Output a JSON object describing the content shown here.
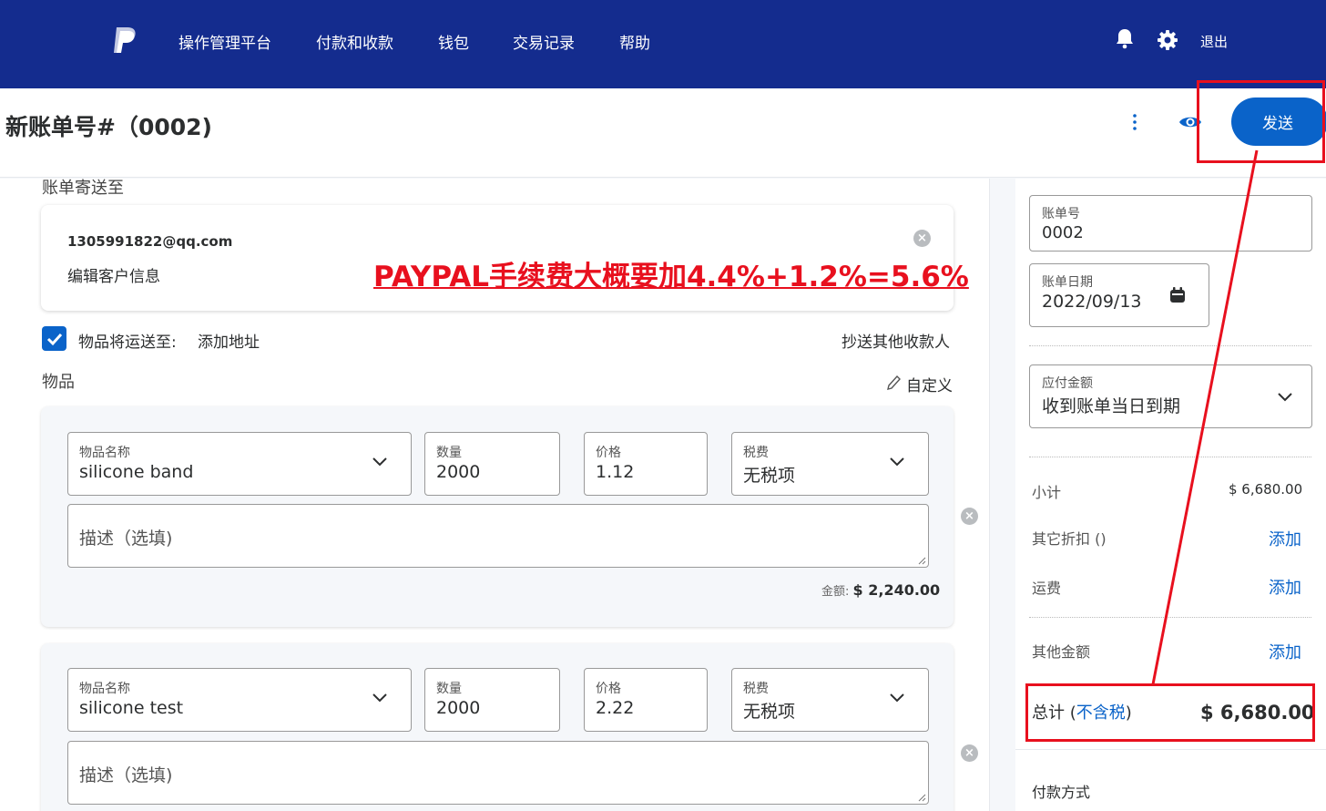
{
  "nav": {
    "items": [
      "操作管理平台",
      "付款和收款",
      "钱包",
      "交易记录",
      "帮助"
    ],
    "logout": "退出",
    "icons": [
      "paypal-logo",
      "bell-icon",
      "gear-icon"
    ]
  },
  "header": {
    "title": "新账单号#（0002)",
    "send_label": "发送"
  },
  "recipient": {
    "section_label": "账单寄送至",
    "email": "1305991822@qq.com",
    "edit_link": "编辑客户信息"
  },
  "annotation": "PAYPAL手续费大概要加4.4%+1.2%=5.6%",
  "shipping": {
    "checked": true,
    "label": "物品将运送至:",
    "add_address": "添加地址",
    "cc_link": "抄送其他收款人"
  },
  "items_section": {
    "label": "物品",
    "customize": "自定义"
  },
  "items": [
    {
      "name_label": "物品名称",
      "name": "silicone band",
      "qty_label": "数量",
      "qty": "2000",
      "price_label": "价格",
      "price": "1.12",
      "tax_label": "税费",
      "tax": "无税项",
      "desc_placeholder": "描述（选填)",
      "amount_label": "金额:",
      "amount": "$ 2,240.00"
    },
    {
      "name_label": "物品名称",
      "name": "silicone test",
      "qty_label": "数量",
      "qty": "2000",
      "price_label": "价格",
      "price": "2.22",
      "tax_label": "税费",
      "tax": "无税项",
      "desc_placeholder": "描述（选填)"
    }
  ],
  "sidebar": {
    "invoice_no_label": "账单号",
    "invoice_no": "0002",
    "invoice_date_label": "账单日期",
    "invoice_date": "2022/09/13",
    "due_label": "应付金额",
    "due_value": "收到账单当日到期",
    "subtotal_label": "小计",
    "subtotal": "$ 6,680.00",
    "discount_label": "其它折扣 ()",
    "shipping_label": "运费",
    "other_label": "其他金额",
    "add_label": "添加",
    "total_label": "总计",
    "total_paren_open": "(",
    "total_tax_link": "不含税",
    "total_paren_close": ")",
    "total": "$ 6,680.00",
    "payment_label": "付款方式"
  },
  "colors": {
    "nav_bg": "#142c8e",
    "accent": "#0a63c9",
    "annotation_red": "#e8101e"
  }
}
